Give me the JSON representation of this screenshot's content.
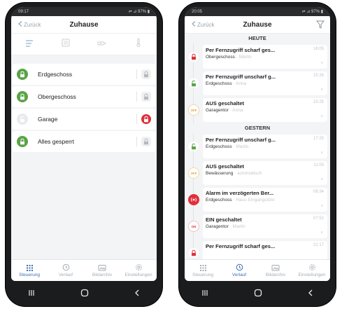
{
  "left": {
    "status": {
      "time": "09:17",
      "right": "⇌ ⊿ 97% ▮"
    },
    "header": {
      "back_label": "Zurück",
      "title": "Zuhause"
    },
    "rows": [
      {
        "label": "Erdgeschoss",
        "locked": true,
        "alarm": false
      },
      {
        "label": "Obergeschoss",
        "locked": true,
        "alarm": false
      },
      {
        "label": "Garage",
        "locked": false,
        "alarm": true
      },
      {
        "label": "Alles gesperrt",
        "locked": true,
        "alarm": false
      }
    ],
    "nav": [
      "Steuerung",
      "Verlauf",
      "Bildarchiv",
      "Einstellungen"
    ],
    "nav_active": 0
  },
  "right": {
    "status": {
      "time": "20:05",
      "right": "⇌ ⊿ 97% ▮"
    },
    "header": {
      "back_label": "Zurück",
      "title": "Zuhause"
    },
    "day_today": "HEUTE",
    "day_yesterday": "GESTERN",
    "today": [
      {
        "title": "Per Fernzugriff scharf ges...",
        "zone": "Obergeschoss",
        "who": "Martin",
        "time": "18:05",
        "badge": "lock-red"
      },
      {
        "title": "Per Fernzugriff unscharf g...",
        "zone": "Erdgeschoss",
        "who": "Anna",
        "time": "15:26",
        "badge": "unlock-green"
      },
      {
        "title": "AUS geschaltet",
        "zone": "Garagentor",
        "who": "Anna",
        "time": "15:25",
        "badge": "off"
      }
    ],
    "yesterday": [
      {
        "title": "Per Fernzugriff unscharf g...",
        "zone": "Erdgeschoss",
        "who": "Martin",
        "time": "17:25",
        "badge": "unlock-green"
      },
      {
        "title": "AUS geschaltet",
        "zone": "Bewässerung",
        "who": "automatisch",
        "time": "11:00",
        "badge": "off"
      },
      {
        "title": "Alarm im verzögerten Ber...",
        "zone": "Erdgeschoss",
        "who": "Haus Eingangstüre",
        "time": "08:34",
        "badge": "alarm"
      },
      {
        "title": "EIN geschaltet",
        "zone": "Garagentor",
        "who": "Martin",
        "time": "07:52",
        "badge": "on"
      },
      {
        "title": "Per Fernzugriff scharf ges...",
        "zone": "",
        "who": "",
        "time": "21:17",
        "badge": "lock-red"
      }
    ],
    "nav": [
      "Steuerung",
      "Verlauf",
      "Bildarchiv",
      "Einstellungen"
    ],
    "nav_active": 1
  },
  "badges": {
    "off": "OFF",
    "on": "ON"
  },
  "colors": {
    "green": "#5aa347",
    "red": "#e0303a",
    "grey": "#c9ccd0",
    "blue": "#3a6fb0",
    "off": "#e3a23a"
  },
  "icons": {
    "back": "chevron-left-icon",
    "filter": "filter-icon",
    "tabs": [
      "list-icon",
      "keypad-icon",
      "door-icon",
      "thermometer-icon"
    ],
    "nav": [
      "grid-icon",
      "history-icon",
      "image-icon",
      "gear-icon"
    ],
    "syskeys": [
      "recent-apps-icon",
      "home-icon",
      "back-icon"
    ]
  }
}
